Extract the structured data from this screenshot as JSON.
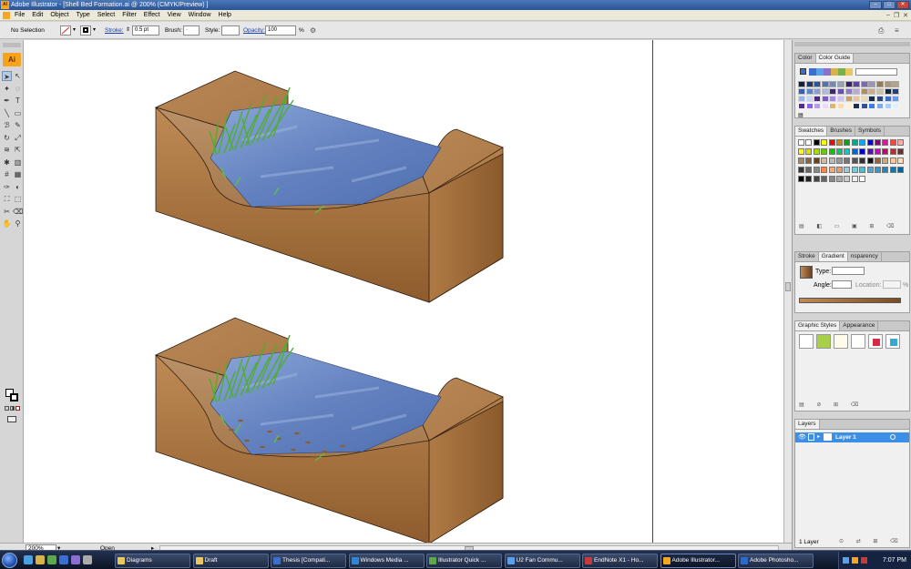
{
  "window": {
    "title": "Adobe Illustrator - [Shell Bed Formation.ai @ 200% (CMYK/Preview) ]",
    "app_icon": "AI"
  },
  "menubar": {
    "items": [
      "File",
      "Edit",
      "Object",
      "Type",
      "Select",
      "Filter",
      "Effect",
      "View",
      "Window",
      "Help"
    ]
  },
  "controlbar": {
    "selection": "No Selection",
    "stroke_label": "Stroke:",
    "stroke_value": "0.5 pt",
    "brush_label": "Brush:",
    "brush_value": "·",
    "style_label": "Style:",
    "opacity_label": "Opacity:",
    "opacity_value": "100",
    "opacity_unit": "%"
  },
  "toolbar": {
    "logo": "Ai",
    "tools": [
      "selection-tool",
      "direct-selection-tool",
      "magic-wand-tool",
      "lasso-tool",
      "pen-tool",
      "type-tool",
      "line-tool",
      "rectangle-tool",
      "paintbrush-tool",
      "pencil-tool",
      "rotate-tool",
      "scale-tool",
      "warp-tool",
      "free-transform-tool",
      "symbol-sprayer-tool",
      "column-graph-tool",
      "mesh-tool",
      "gradient-tool",
      "eyedropper-tool",
      "blend-tool",
      "live-paint-tool",
      "live-paint-selection-tool",
      "slice-tool",
      "eraser-tool",
      "hand-tool",
      "zoom-tool"
    ]
  },
  "status": {
    "zoom": "200%",
    "state": "Open"
  },
  "panels": {
    "color_tabs": [
      "Color",
      "Color Guide"
    ],
    "swatch_tabs": [
      "Swatches",
      "Brushes",
      "Symbols"
    ],
    "gradient_tabs": [
      "Stroke",
      "Gradient",
      "nsparency"
    ],
    "gradient": {
      "type_label": "Type:",
      "angle_label": "Angle:",
      "location_label": "Location:",
      "location_unit": "%"
    },
    "style_tabs": [
      "Graphic Styles",
      "Appearance"
    ],
    "layer_tabs": [
      "Layers"
    ],
    "layers": [
      {
        "name": "Layer 1"
      }
    ],
    "layer_count": "1 Layer"
  },
  "taskbar": {
    "tasks": [
      {
        "label": "Diagrams",
        "icon_color": "#e8c760"
      },
      {
        "label": "Draft",
        "icon_color": "#e8c760"
      },
      {
        "label": "Thesis [Compati...",
        "icon_color": "#3a6fd0"
      },
      {
        "label": "Windows Media ...",
        "icon_color": "#2f86d8"
      },
      {
        "label": "Illustrator Quick ...",
        "icon_color": "#5da84a"
      },
      {
        "label": "U2 Fan Commu...",
        "icon_color": "#5aa0e8"
      },
      {
        "label": "EndNote X1 - Ho...",
        "icon_color": "#c83a3a"
      },
      {
        "label": "Adobe Illustrator...",
        "icon_color": "#f5a623",
        "active": true
      },
      {
        "label": "Adobe Photosho...",
        "icon_color": "#2a6bd1"
      }
    ],
    "clock": "7:07 PM"
  },
  "colors": {
    "soil_light": "#c08a55",
    "soil_dark": "#7a4e25",
    "water": "#6f8ec8",
    "grass": "#54b232",
    "accent": "#f5a623"
  }
}
